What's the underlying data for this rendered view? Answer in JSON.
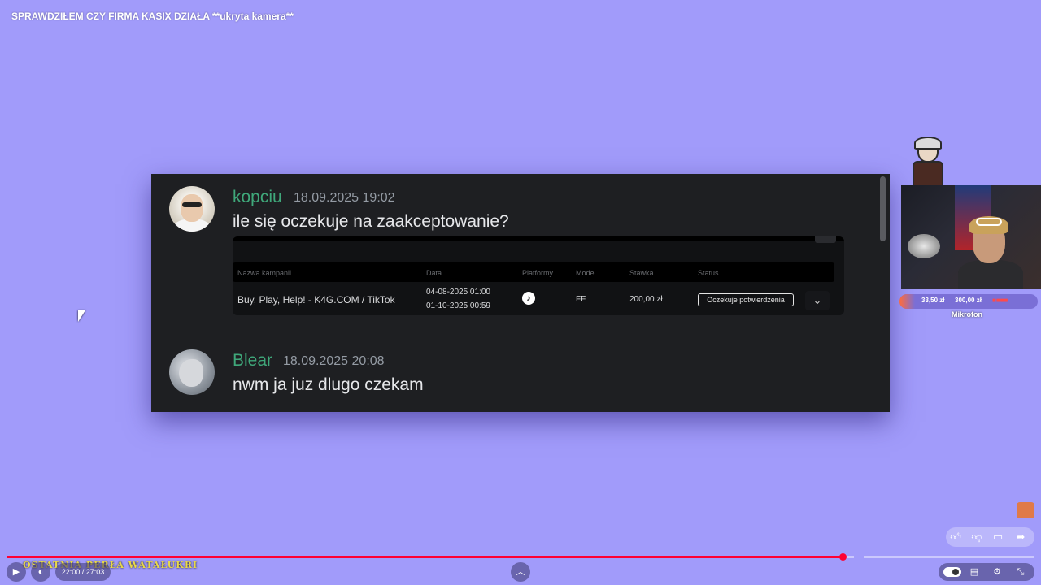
{
  "video": {
    "title": "SPRAWDZIŁEM CZY FIRMA KASIX DZIAŁA **ukryta kamera**"
  },
  "chat": {
    "messages": [
      {
        "username": "kopciu",
        "timestamp": "18.09.2025 19:02",
        "text": "ile się oczekuje na zaakceptowanie?",
        "username_color": "#3fa77a"
      },
      {
        "username": "Blear",
        "timestamp": "18.09.2025 20:08",
        "text": "nwm ja juz dlugo czekam",
        "username_color": "#3fa77a"
      }
    ],
    "embed": {
      "headers": [
        "Nazwa kampanii",
        "Data",
        "Platformy",
        "Model",
        "Stawka",
        "Status"
      ],
      "row": {
        "campaign": "Buy, Play, Help! - K4G.COM / TikTok",
        "date_start": "04-08-2025 01:00",
        "date_end": "01-10-2025 00:59",
        "platform_icon": "tiktok-icon",
        "model": "FF",
        "rate": "200,00 zł",
        "status": "Oczekuje potwierdzenia"
      }
    }
  },
  "overlay": {
    "donation_current": "33,50 zł",
    "donation_goal": "300,00 zł",
    "donation_progress": 0.11,
    "mic_label": "Mikrofon",
    "bottom_banner": "OSTATNIA PERŁA WATAŁUKRI"
  },
  "player": {
    "time": "22:00 / 27:03",
    "progress": 0.813,
    "accent_color": "#ff0033",
    "icons": [
      "play-icon",
      "volume-icon",
      "chevron-up-icon",
      "autoplay-toggle",
      "subtitles-icon",
      "settings-icon",
      "exit-fullscreen-icon",
      "like-icon",
      "dislike-icon",
      "comments-icon",
      "share-icon"
    ]
  },
  "colors": {
    "background": "#a19bfa",
    "chat_panel": "#1e1f22"
  }
}
